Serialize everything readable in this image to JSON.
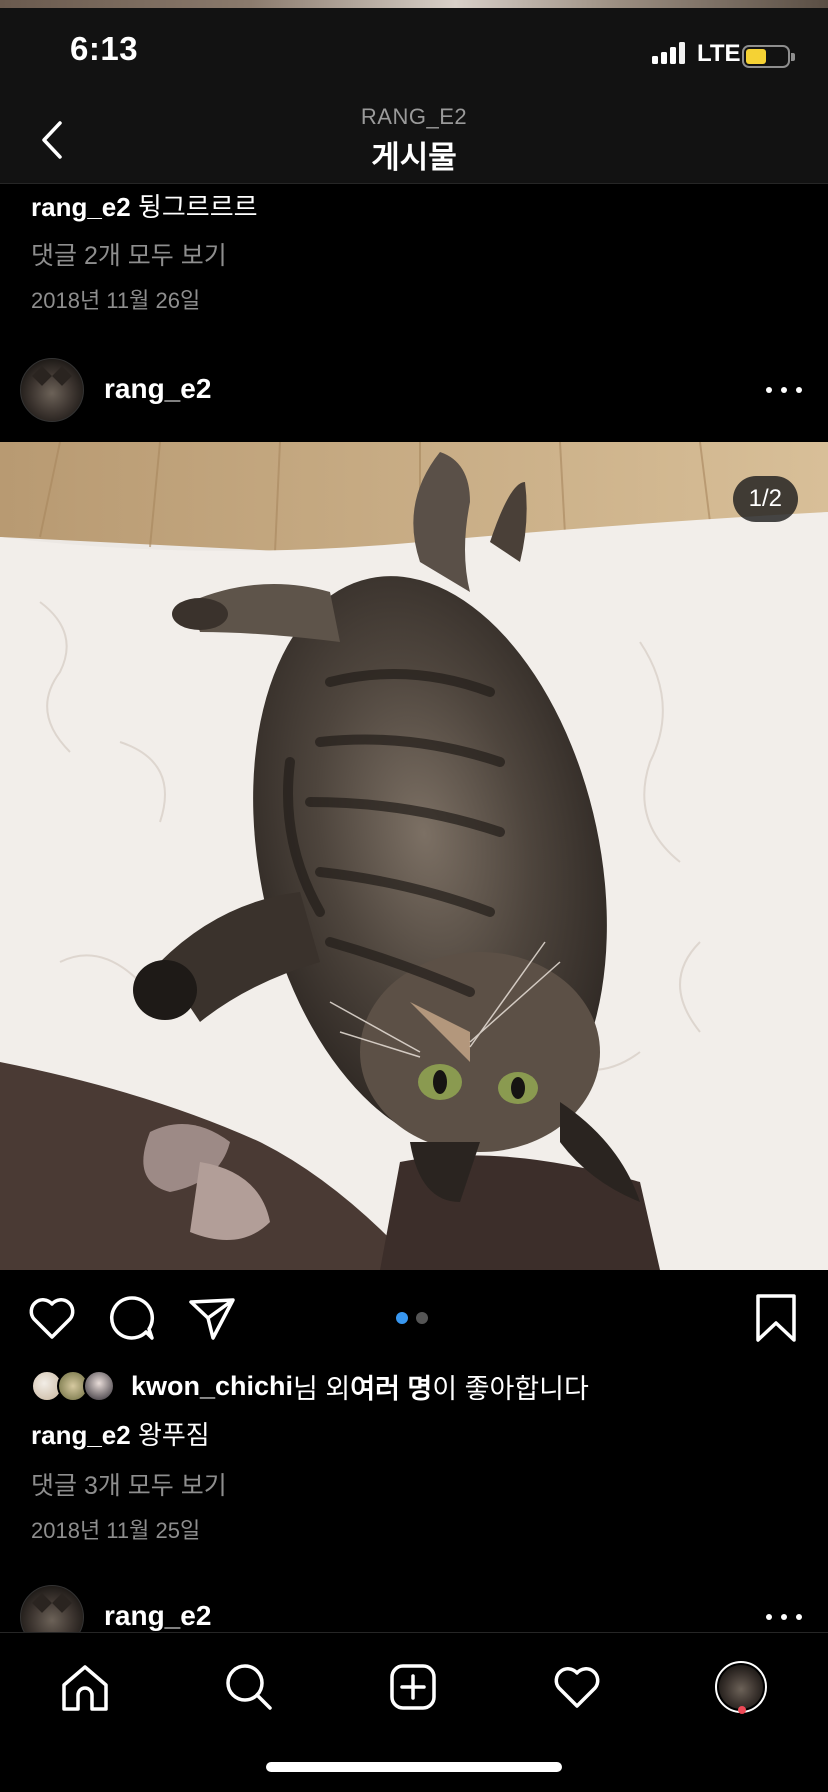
{
  "status_bar": {
    "time": "6:13",
    "network": "LTE",
    "battery_level": 0.5
  },
  "nav": {
    "username": "RANG_E2",
    "title": "게시물"
  },
  "previous_post": {
    "caption_user": "rang_e2",
    "caption_text": "뒹그르르르",
    "view_comments": "댓글 2개 모두 보기",
    "date": "2018년 11월 26일"
  },
  "post": {
    "username": "rang_e2",
    "image_counter": "1/2",
    "carousel": {
      "total": 2,
      "active": 0,
      "active_color": "#3897f0",
      "inactive_color": "#555555"
    },
    "likes": {
      "user": "kwon_chichi",
      "suffix_1": "님 외 ",
      "bold_2": "여러 명",
      "suffix_2": "이 좋아합니다"
    },
    "caption_user": "rang_e2",
    "caption_text": "왕푸짐",
    "view_comments": "댓글 3개 모두 보기",
    "date": "2018년 11월 25일"
  },
  "next_post": {
    "username": "rang_e2"
  },
  "icons": {
    "back": "chevron-left-icon",
    "more": "more-icon",
    "like": "heart-icon",
    "comment": "comment-icon",
    "share": "paper-plane-icon",
    "save": "bookmark-icon",
    "home": "home-icon",
    "search": "search-icon",
    "add": "add-post-icon",
    "activity": "heart-icon",
    "profile": "profile-avatar"
  },
  "colors": {
    "background": "#000000",
    "muted_text": "#8e8e8e",
    "accent": "#3897f0",
    "notification": "#ed4956",
    "battery": "#f5d234"
  }
}
